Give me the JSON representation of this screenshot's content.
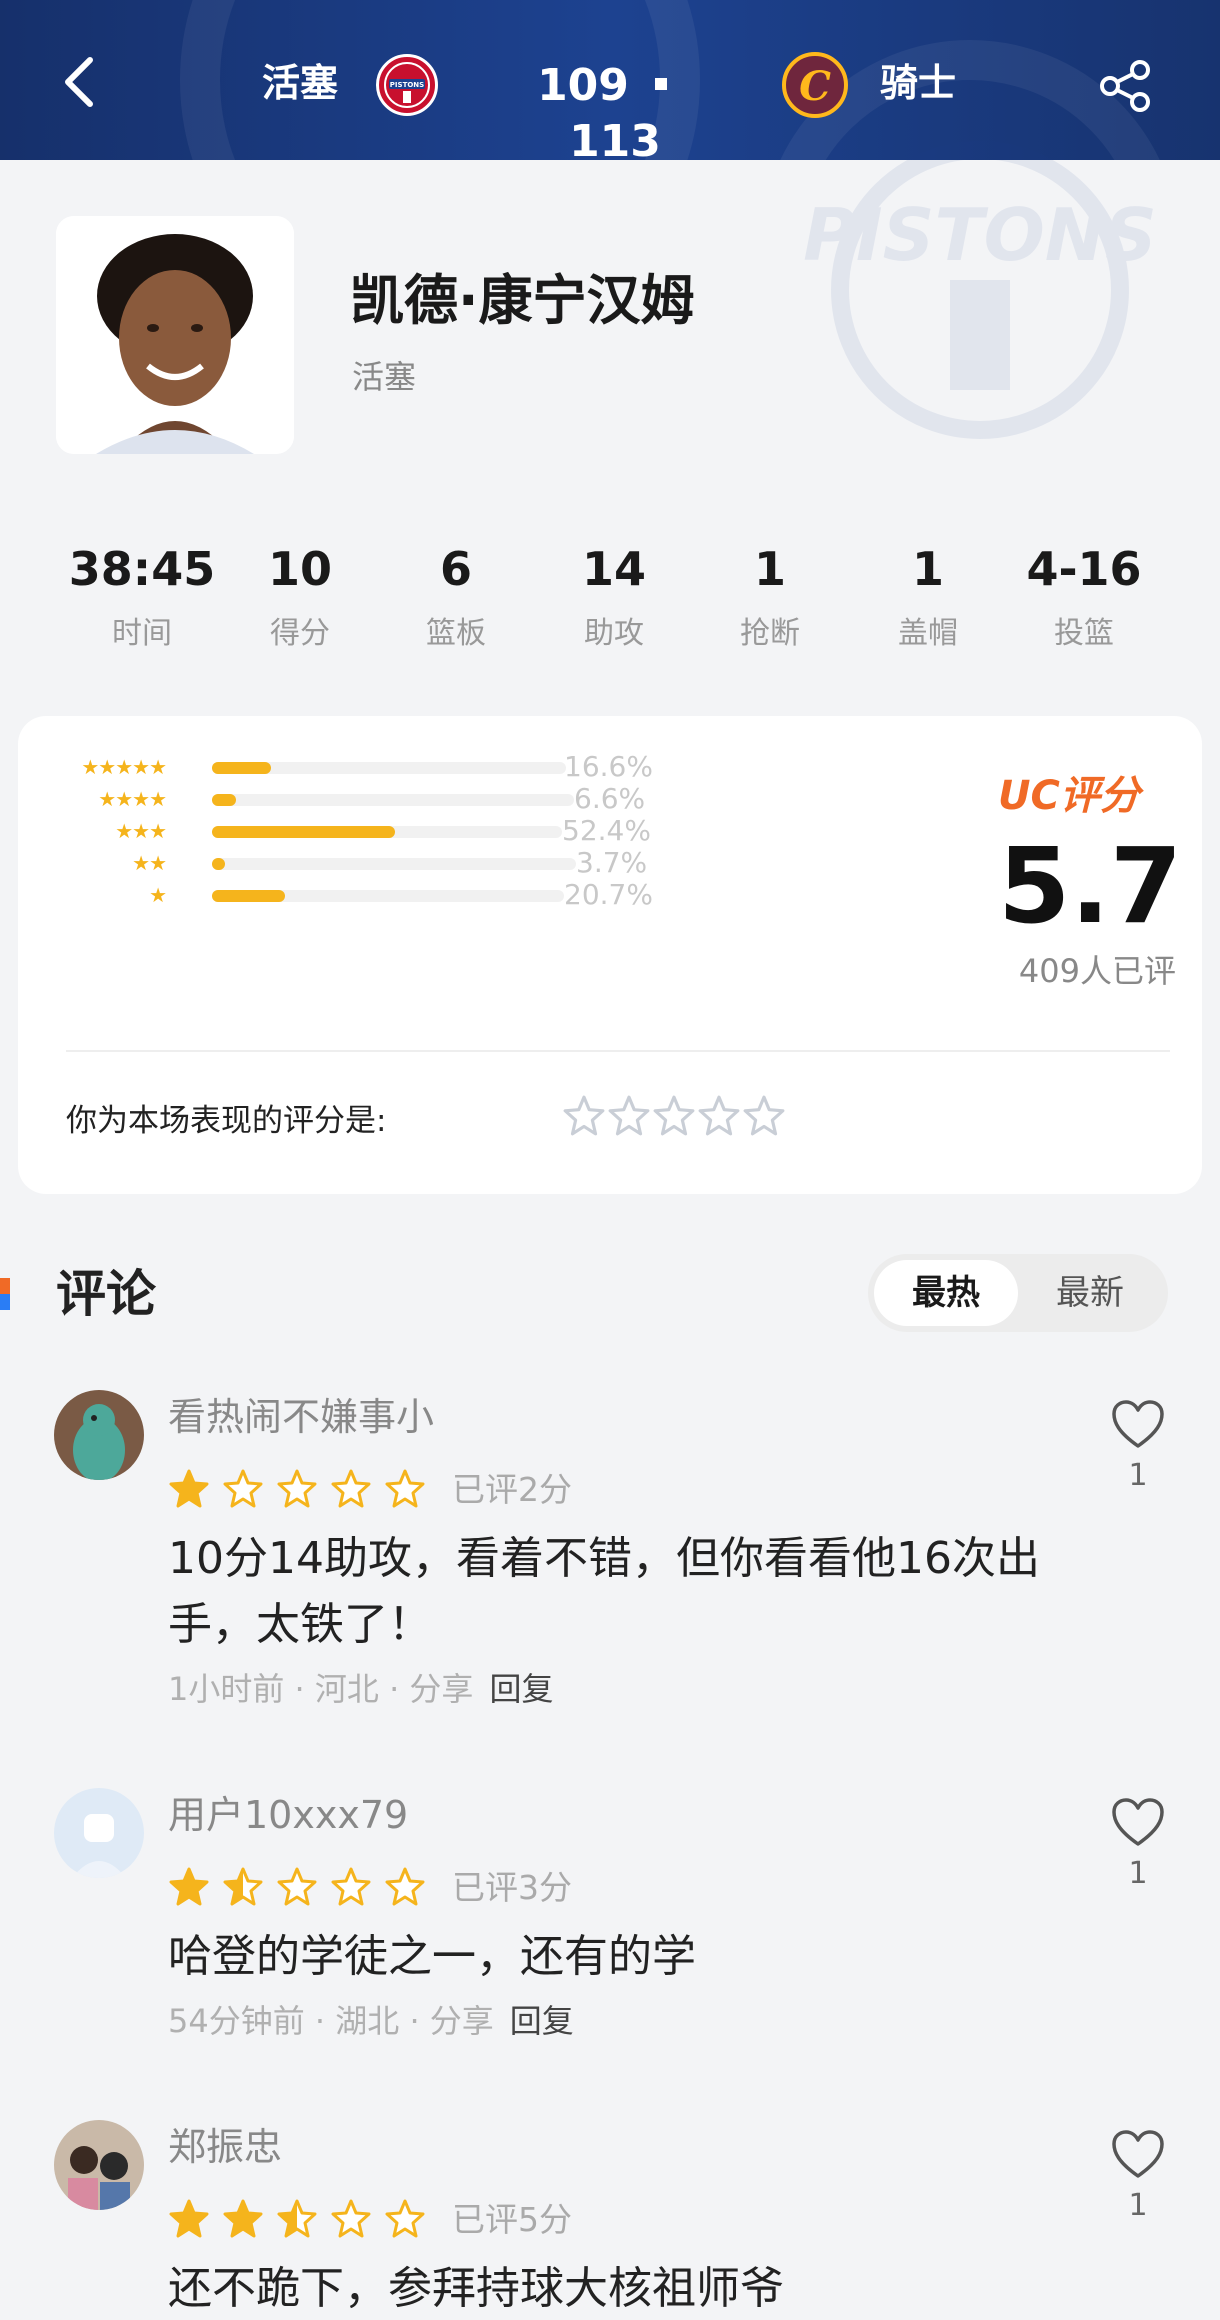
{
  "header": {
    "home_team": "活塞",
    "home_score": "109",
    "away_score": "113",
    "away_team": "骑士",
    "home_logo_text": "PISTONS",
    "away_logo_text": "C"
  },
  "watermark_text": "PISTONS",
  "player": {
    "name": "凯德·康宁汉姆",
    "team": "活塞"
  },
  "stats": [
    {
      "value": "38:45",
      "label": "时间"
    },
    {
      "value": "10",
      "label": "得分"
    },
    {
      "value": "6",
      "label": "篮板"
    },
    {
      "value": "14",
      "label": "助攻"
    },
    {
      "value": "1",
      "label": "抢断"
    },
    {
      "value": "1",
      "label": "盖帽"
    },
    {
      "value": "4-16",
      "label": "投篮"
    }
  ],
  "rating": {
    "distribution": [
      {
        "stars": 5,
        "percent": 16.6,
        "label": "16.6%"
      },
      {
        "stars": 4,
        "percent": 6.6,
        "label": "6.6%"
      },
      {
        "stars": 3,
        "percent": 52.4,
        "label": "52.4%"
      },
      {
        "stars": 2,
        "percent": 3.7,
        "label": "3.7%"
      },
      {
        "stars": 1,
        "percent": 20.7,
        "label": "20.7%"
      }
    ],
    "uc_label": "UC评分",
    "score": "5.7",
    "count_text": "409人已评",
    "my_rating_label": "你为本场表现的评分是:",
    "my_rating_stars": 0
  },
  "comments_section": {
    "title": "评论",
    "tabs": [
      "最热",
      "最新"
    ],
    "active_tab": 0
  },
  "comments": [
    {
      "user": "看热闹不嫌事小",
      "stars": 1,
      "rated_text": "已评2分",
      "text": "10分14助攻，看着不错，但你看看他16次出手，太铁了！",
      "time": "1小时前",
      "region": "河北",
      "share": "分享",
      "reply": "回复",
      "likes": "1"
    },
    {
      "user": "用户10xxx79",
      "stars": 1.5,
      "rated_text": "已评3分",
      "text": "哈登的学徒之一，还有的学",
      "time": "54分钟前",
      "region": "湖北",
      "share": "分享",
      "reply": "回复",
      "likes": "1"
    },
    {
      "user": "郑振忠",
      "stars": 2.5,
      "rated_text": "已评5分",
      "text": "还不跪下，参拜持球大核祖师爷",
      "likes": "1"
    }
  ],
  "colors": {
    "header_bg": "#1d4290",
    "star_gold": "#f5b41c",
    "uc_orange": "#f06a26",
    "comment_star": "#f5b41c"
  }
}
